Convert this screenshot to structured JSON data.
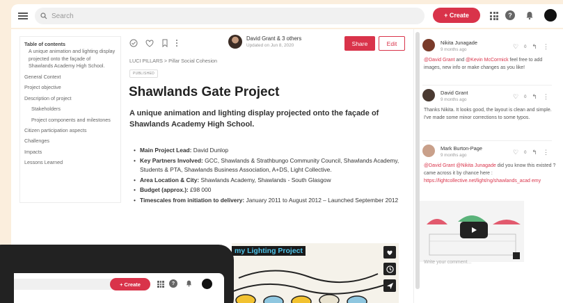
{
  "topbar": {
    "search_placeholder": "Search",
    "create_label": "+ Create",
    "help_glyph": "?"
  },
  "toc": {
    "title": "Table of contents",
    "subtitle": "A unique animation and lighting display projected onto the façade of Shawlands Academy High School.",
    "items": [
      {
        "label": "General Context"
      },
      {
        "label": "Project objective"
      },
      {
        "label": "Description of project"
      },
      {
        "label": "Stakeholders",
        "sub": true
      },
      {
        "label": "Project components and milestones",
        "sub": true
      },
      {
        "label": "Citizen participation aspects"
      },
      {
        "label": "Challenges"
      },
      {
        "label": "Impacts"
      },
      {
        "label": "Lessons Learned"
      }
    ]
  },
  "doc": {
    "author": "David Grant & 3 others",
    "updated": "Updated on Jun 8, 2020",
    "share_label": "Share",
    "edit_label": "Edit",
    "breadcrumb": "LUCI PILLARS > Pillar Social Cohesion",
    "status": "PUBLISHED",
    "title": "Shawlands Gate Project",
    "subtitle": "A unique animation and lighting display projected onto the façade of Shawlands Academy High School.",
    "bullets": [
      {
        "label": "Main Project Lead:",
        "value": " David Dunlop"
      },
      {
        "label": "Key Partners Involved:",
        "value": " GCC, Shawlands & Strathbungo Community Council, Shawlands Academy, Students & PTA, Shawlands Business Association, A+DS, Light Collective."
      },
      {
        "label": "Area Location & City:",
        "value": " Shawlands Academy, Shawlands - South Glasgow"
      },
      {
        "label": "Budget (approx.):",
        "value": " £98 000"
      },
      {
        "label": "Timescales from initiation to delivery:",
        "value": " January 2011 to August 2012 – Launched September 2012"
      }
    ],
    "video_title": "my Lighting Project"
  },
  "comments": [
    {
      "name": "Nikita Junagade",
      "time": "9 months ago",
      "likes": "0",
      "body_parts": [
        {
          "text": "@David Grant",
          "mention": true
        },
        {
          "text": " and ",
          "mention": false
        },
        {
          "text": "@Kevin McCormick",
          "mention": true
        },
        {
          "text": " feel free to add images, new info or make changes as you like!",
          "mention": false
        }
      ],
      "avatar_color": "#7a3b2a"
    },
    {
      "name": "David Grant",
      "time": "9 months ago",
      "likes": "0",
      "body_parts": [
        {
          "text": "Thanks Nikita. It looks good, the layout is clean and simple. I've made some minor corrections to some typos.",
          "mention": false
        }
      ],
      "avatar_color": "#4a3a32"
    },
    {
      "name": "Mark Burton-Page",
      "time": "9 months ago",
      "likes": "0",
      "body_parts": [
        {
          "text": "@David Grant",
          "mention": true
        },
        {
          "text": " ",
          "mention": false
        },
        {
          "text": "@Nikita Junagade",
          "mention": true
        },
        {
          "text": " did you know this existed ? came across it by chance here : ",
          "mention": false
        },
        {
          "text": "https://lightcollective.net/light/ng/shawlands_acad emy",
          "mention": true
        }
      ],
      "avatar_color": "#c9a08a"
    }
  ],
  "reply_placeholder": "Write your comment...",
  "tablet": {
    "create_label": "+ Create",
    "help_glyph": "?"
  },
  "colors": {
    "accent": "#d9334a",
    "background": "#fbeedd"
  }
}
